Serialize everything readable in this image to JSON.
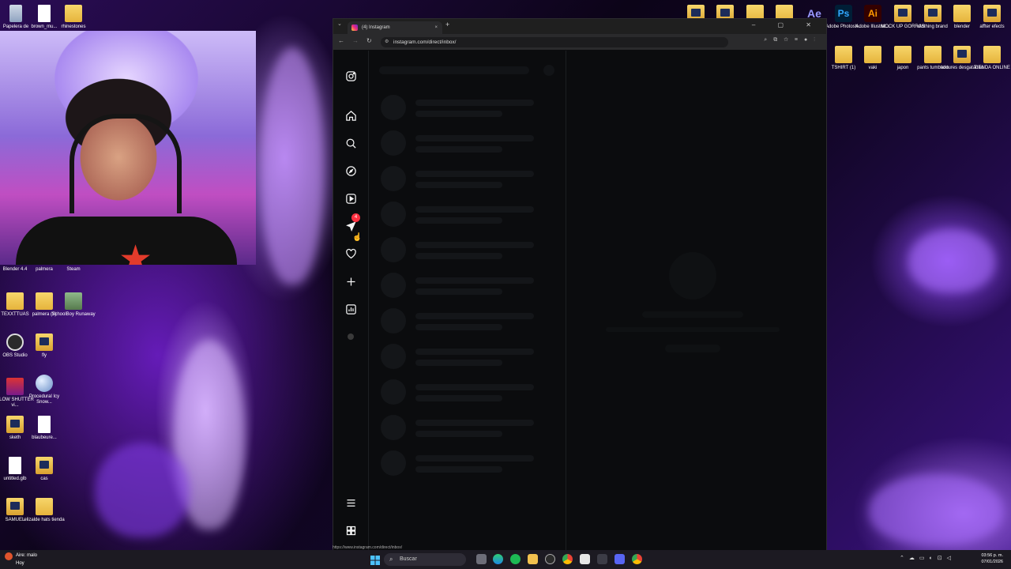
{
  "desktop": {
    "icons_left": [
      {
        "label": "Papelera de"
      },
      {
        "label": "brown_mu..."
      },
      {
        "label": "rhinestones"
      },
      {
        "label": "Blender 4.4"
      },
      {
        "label": "palmera"
      },
      {
        "label": "Steam"
      },
      {
        "label": "TEXXTTUAS"
      },
      {
        "label": "palmera (2)"
      },
      {
        "label": "SchoolBoy Runaway"
      },
      {
        "label": "OBS Studio"
      },
      {
        "label": "fly"
      },
      {
        "label": "SLOW SHUTTER vi..."
      },
      {
        "label": "Procedural Icy Snow..."
      },
      {
        "label": "sketh"
      },
      {
        "label": "blaubeure..."
      },
      {
        "label": "untitled.glb"
      },
      {
        "label": "cas"
      },
      {
        "label": "SAMUEL"
      },
      {
        "label": "elizalde hats tienda"
      }
    ],
    "icons_right_row1": [
      {
        "label": "Adobe Photosh..."
      },
      {
        "label": "Adobe Illustrat..."
      },
      {
        "label": "MOCK UP GORRAS"
      },
      {
        "label": "clothing brand"
      },
      {
        "label": "blender"
      },
      {
        "label": "affter efects"
      }
    ],
    "icons_right_row2": [
      {
        "label": "TSHIRT (1)"
      },
      {
        "label": "vaki"
      },
      {
        "label": "japon"
      },
      {
        "label": "pants tumbado"
      },
      {
        "label": "textures desgatadao"
      },
      {
        "label": "TIENDA ONLINE"
      }
    ],
    "top_app_glyphs": {
      "ae": "Ae",
      "ps": "Ps",
      "ai": "Ai"
    }
  },
  "browser": {
    "tab_title": "(4) Instagram",
    "tab_close": "×",
    "new_tab": "+",
    "url": "instagram.com/direct/inbox/",
    "status_url": "https://www.instagram.com/direct/inbox/",
    "window_controls": "–  ▢  ✕"
  },
  "instagram": {
    "messages_badge": "4"
  },
  "taskbar": {
    "weather_title": "Aire: malo",
    "weather_sub": "Hoy",
    "search_placeholder": "Buscar",
    "time": "03:56 p. m.",
    "date": "07/01/2026"
  },
  "colors": {
    "badge": "#ff3040",
    "browser_bg": "#0b0c0e",
    "skeleton": "#141619"
  }
}
